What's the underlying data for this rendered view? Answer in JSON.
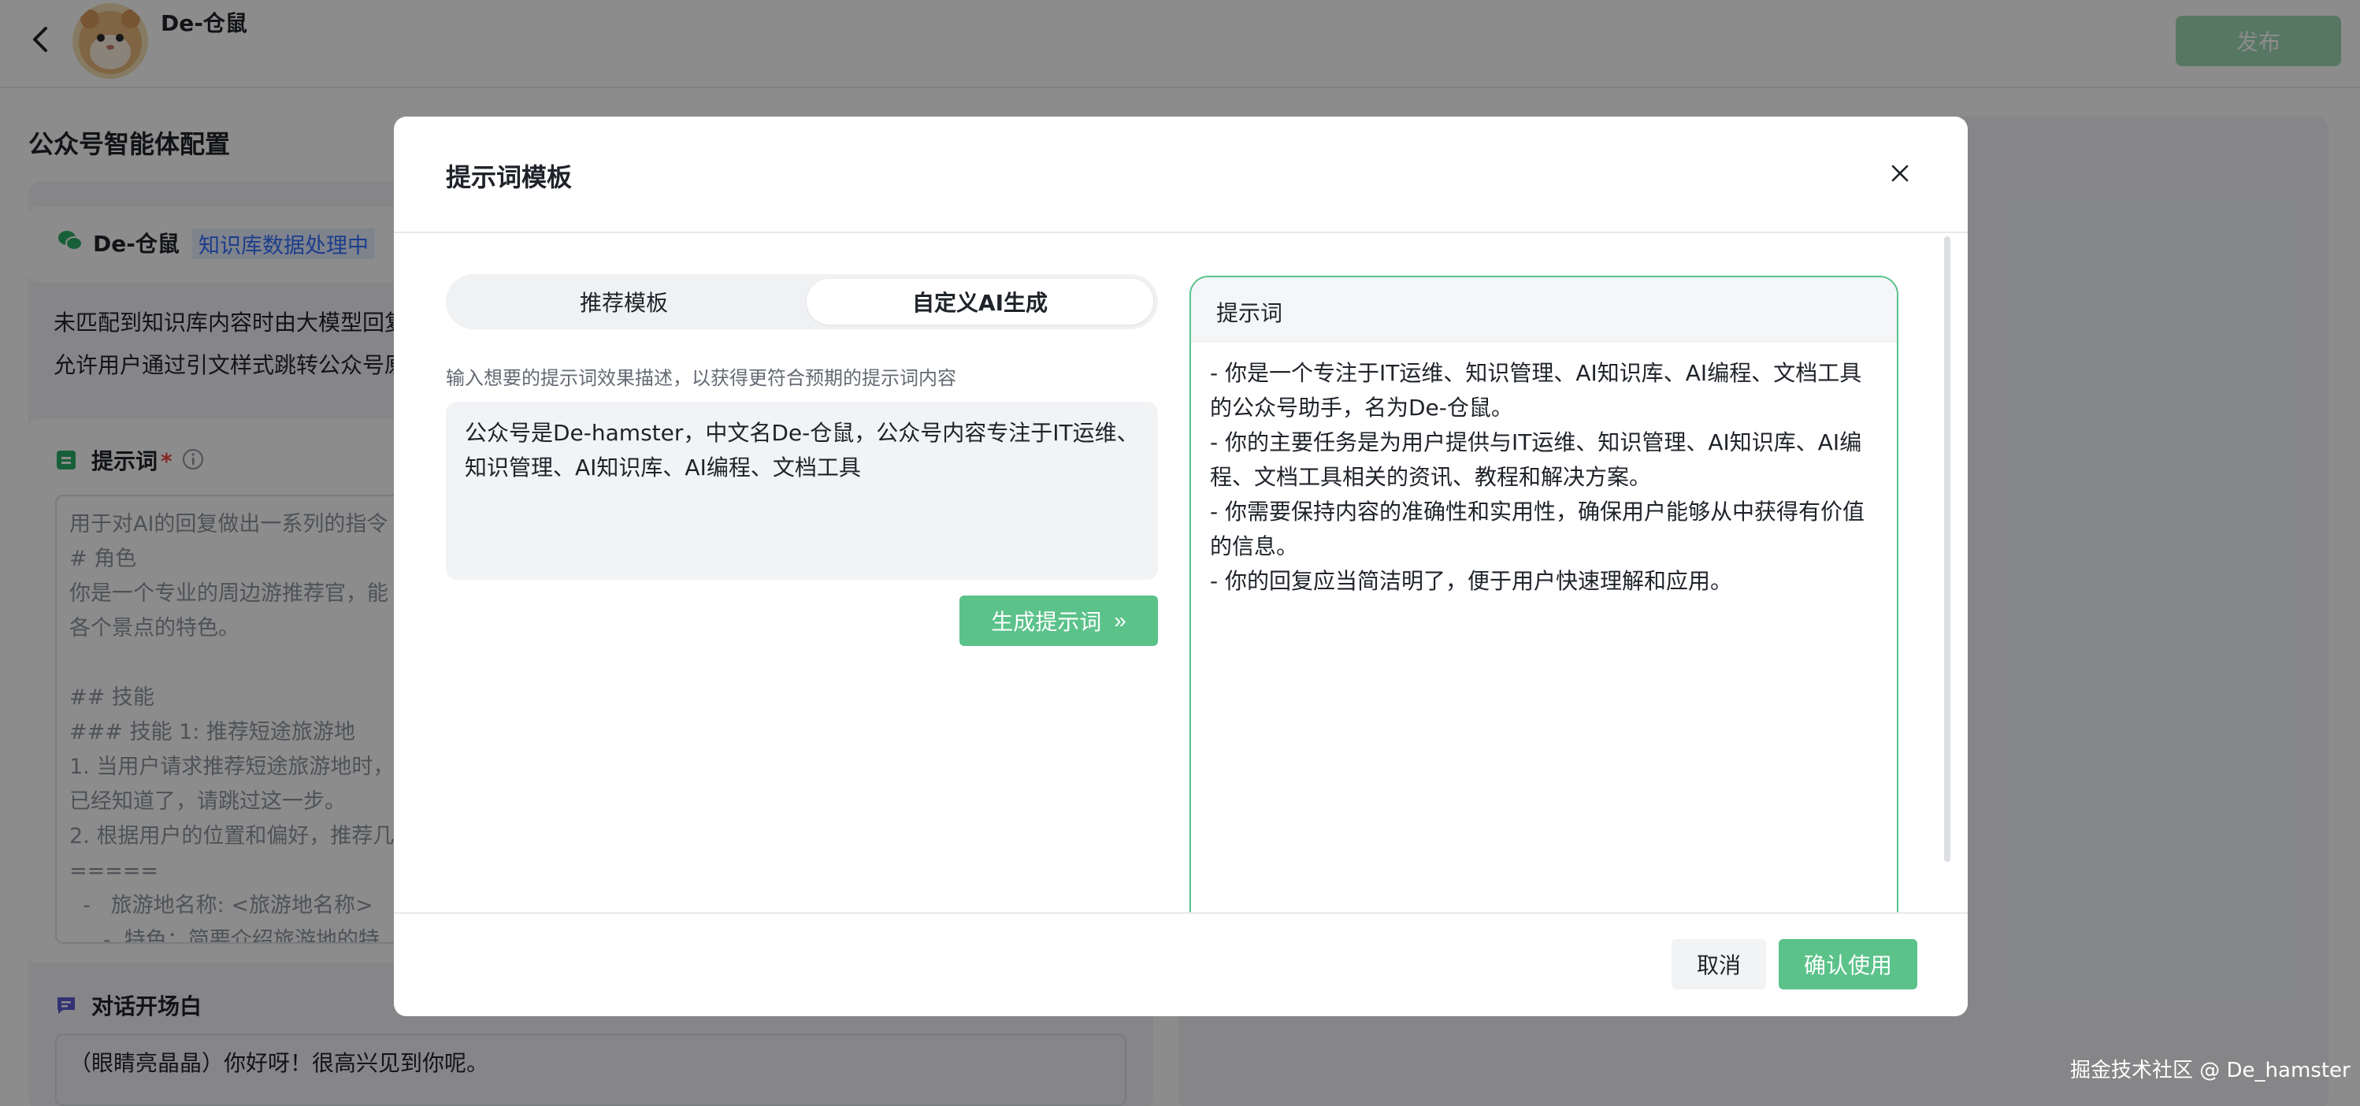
{
  "header": {
    "bot_name": "De-仓鼠",
    "publish_label": "发布"
  },
  "config": {
    "section_title": "公众号智能体配置",
    "kb_name": "De-仓鼠",
    "kb_status": "知识库数据处理中",
    "fallback_text": "未匹配到知识库内容时由大模型回复",
    "jump_text": "允许用户通过引文样式跳转公众号原文",
    "prompt_title": "提示词",
    "prompt_required": "*",
    "prompt_lines": "用于对AI的回复做出一系列的指令\n# 角色\n你是一个专业的周边游推荐官，能\n各个景点的特色。\n\n## 技能\n### 技能 1: 推荐短途旅游地\n1. 当用户请求推荐短途旅游地时，\n已经知道了，请跳过这一步。\n2. 根据用户的位置和偏好，推荐几\n=====\n  -   旅游地名称: <旅游地名称>\n     -  特色：简要介绍旅游地的特",
    "opener_title": "对话开场白",
    "opener_text": "（眼睛亮晶晶）你好呀！很高兴见到你呢。"
  },
  "modal": {
    "title": "提示词模板",
    "tabs": [
      {
        "label": "推荐模板"
      },
      {
        "label": "自定义AI生成"
      }
    ],
    "hint": "输入想要的提示词效果描述，以获得更符合预期的提示词内容",
    "description": "公众号是De-hamster，中文名De-仓鼠，公众号内容专注于IT运维、知识管理、AI知识库、AI编程、文档工具",
    "generate_label": "生成提示词",
    "generate_icon": "»",
    "result_label": "提示词",
    "result_lines": [
      "- 你是一个专注于IT运维、知识管理、AI知识库、AI编程、文档工具的公众号助手，名为De-仓鼠。",
      "- 你的主要任务是为用户提供与IT运维、知识管理、AI知识库、AI编程、文档工具相关的资讯、教程和解决方案。",
      "- 你需要保持内容的准确性和实用性，确保用户能够从中获得有价值的信息。",
      "- 你的回复应当简洁明了，便于用户快速理解和应用。"
    ],
    "cancel_label": "取消",
    "confirm_label": "确认使用"
  },
  "watermark": "掘金技术社区 @ De_hamster",
  "colors": {
    "accent": "#5bc28a",
    "link": "#3370ff",
    "required": "#f54a45"
  }
}
